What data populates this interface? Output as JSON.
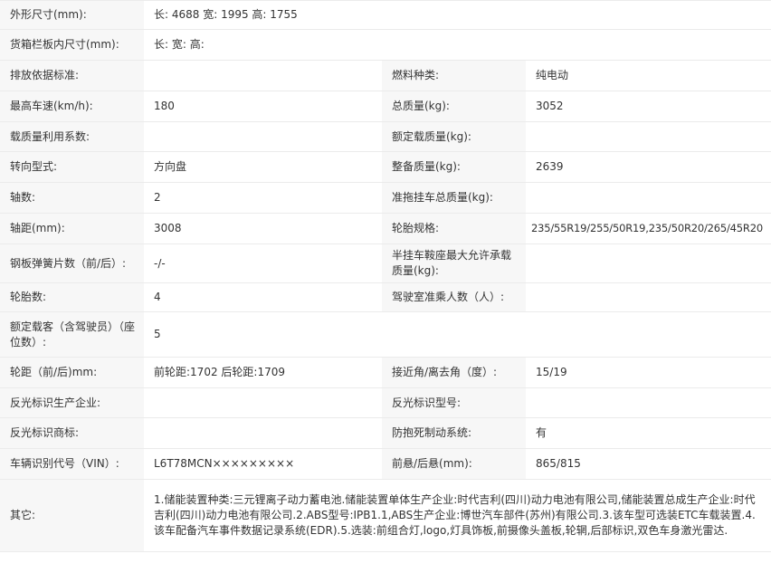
{
  "rows": [
    {
      "k1": "外形尺寸(mm):",
      "v1": "长: 4688 宽: 1995 高: 1755"
    },
    {
      "k1": "货箱栏板内尺寸(mm):",
      "v1": "长:  宽:  高:"
    },
    {
      "k1": "排放依据标准:",
      "v1": "",
      "k2": "燃料种类:",
      "v2": "纯电动"
    },
    {
      "k1": "最高车速(km/h):",
      "v1": "180",
      "k2": "总质量(kg):",
      "v2": "3052"
    },
    {
      "k1": "载质量利用系数:",
      "v1": "",
      "k2": "额定载质量(kg):",
      "v2": ""
    },
    {
      "k1": "转向型式:",
      "v1": "方向盘",
      "k2": "整备质量(kg):",
      "v2": "2639"
    },
    {
      "k1": "轴数:",
      "v1": "2",
      "k2": "准拖挂车总质量(kg):",
      "v2": ""
    },
    {
      "k1": "轴距(mm):",
      "v1": "3008",
      "k2": "轮胎规格:",
      "v2": "235/55R19/255/50R19,235/50R20/265/45R20"
    },
    {
      "k1": "钢板弹簧片数（前/后）:",
      "v1": "-/-",
      "k2": "半挂车鞍座最大允许承载质量(kg):",
      "v2": ""
    },
    {
      "k1": "轮胎数:",
      "v1": "4",
      "k2": "驾驶室准乘人数（人）:",
      "v2": ""
    },
    {
      "k1": "额定载客（含驾驶员）（座位数）:",
      "v1": "5"
    },
    {
      "k1": "轮距（前/后)mm:",
      "v1": "前轮距:1702 后轮距:1709",
      "k2": "接近角/离去角（度）:",
      "v2": "15/19"
    },
    {
      "k1": "反光标识生产企业:",
      "v1": "",
      "k2": "反光标识型号:",
      "v2": ""
    },
    {
      "k1": "反光标识商标:",
      "v1": "",
      "k2": "防抱死制动系统:",
      "v2": "有"
    },
    {
      "k1": "车辆识别代号（VIN）:",
      "v1": "L6T78MCN×××××××××",
      "k2": "前悬/后悬(mm):",
      "v2": "865/815"
    }
  ],
  "other": {
    "label": "其它:",
    "value": "1.储能装置种类:三元锂离子动力蓄电池.储能装置单体生产企业:时代吉利(四川)动力电池有限公司,储能装置总成生产企业:时代吉利(四川)动力电池有限公司.2.ABS型号:IPB1.1,ABS生产企业:博世汽车部件(苏州)有限公司.3.该车型可选装ETC车载装置.4.该车配备汽车事件数据记录系统(EDR).5.选装:前组合灯,logo,灯具饰板,前摄像头盖板,轮辋,后部标识,双色车身激光雷达."
  }
}
